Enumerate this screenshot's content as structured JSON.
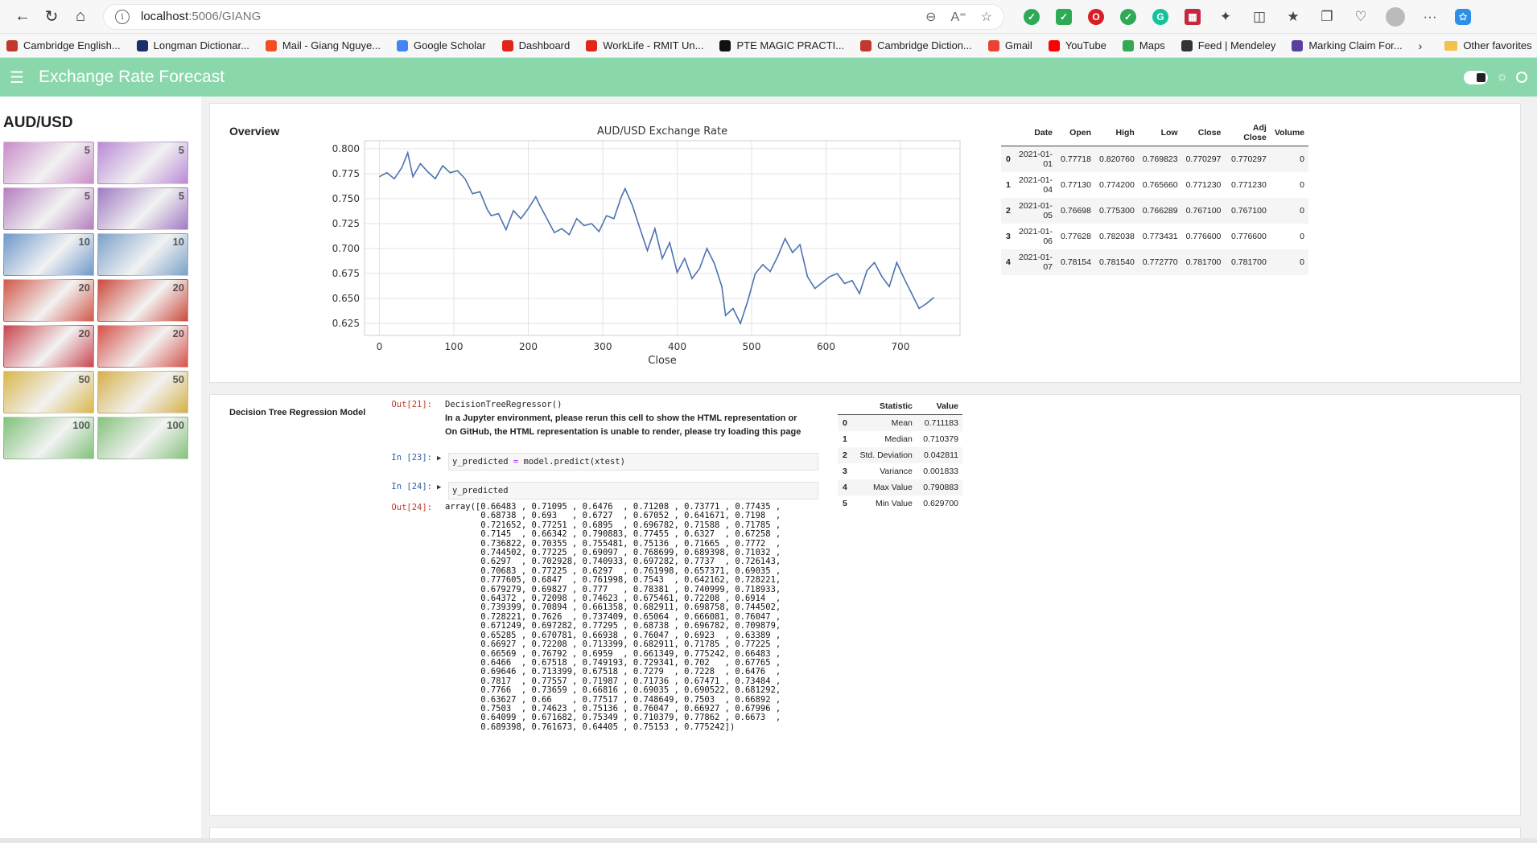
{
  "browser": {
    "url_host": "localhost",
    "url_path": ":5006/GIANG",
    "bookmarks": [
      {
        "label": "Cambridge English...",
        "color": "#c0392b"
      },
      {
        "label": "Longman Dictionar...",
        "color": "#1c2f6b"
      },
      {
        "label": "Mail - Giang Nguye...",
        "color": "#f25022"
      },
      {
        "label": "Google Scholar",
        "color": "#4285f4"
      },
      {
        "label": "Dashboard",
        "color": "#e1251b"
      },
      {
        "label": "WorkLife - RMIT Un...",
        "color": "#e1251b"
      },
      {
        "label": "PTE MAGIC PRACTI...",
        "color": "#111111"
      },
      {
        "label": "Cambridge Diction...",
        "color": "#c0392b"
      },
      {
        "label": "Gmail",
        "color": "#ea4335"
      },
      {
        "label": "YouTube",
        "color": "#ff0000"
      },
      {
        "label": "Maps",
        "color": "#34a853"
      },
      {
        "label": "Feed | Mendeley",
        "color": "#333333"
      },
      {
        "label": "Marking Claim For...",
        "color": "#5b3fa0"
      }
    ],
    "other_favorites": "Other favorites"
  },
  "app": {
    "title": "Exchange Rate Forecast",
    "accent": "#8ad7ac"
  },
  "sidebar": {
    "pair": "AUD/USD",
    "notes": [
      {
        "denom": "5",
        "color": "#c98cc9"
      },
      {
        "denom": "5",
        "color": "#b98ad6"
      },
      {
        "denom": "5",
        "color": "#b47fbf"
      },
      {
        "denom": "5",
        "color": "#a07bc4"
      },
      {
        "denom": "10",
        "color": "#6f98cc"
      },
      {
        "denom": "10",
        "color": "#7ba1c9"
      },
      {
        "denom": "20",
        "color": "#d1584a"
      },
      {
        "denom": "20",
        "color": "#cc4a3c"
      },
      {
        "denom": "20",
        "color": "#c9454f"
      },
      {
        "denom": "20",
        "color": "#d6524a"
      },
      {
        "denom": "50",
        "color": "#d9b64c"
      },
      {
        "denom": "50",
        "color": "#d6b04a"
      },
      {
        "denom": "100",
        "color": "#7fc27a"
      },
      {
        "denom": "100",
        "color": "#86c27d"
      }
    ]
  },
  "overview": {
    "title": "Overview",
    "table": {
      "columns": [
        "",
        "Date",
        "Open",
        "High",
        "Low",
        "Close",
        "Adj Close",
        "Volume"
      ],
      "rows": [
        [
          "0",
          "2021-01-01",
          "0.77718",
          "0.820760",
          "0.769823",
          "0.770297",
          "0.770297",
          "0"
        ],
        [
          "1",
          "2021-01-04",
          "0.77130",
          "0.774200",
          "0.765660",
          "0.771230",
          "0.771230",
          "0"
        ],
        [
          "2",
          "2021-01-05",
          "0.76698",
          "0.775300",
          "0.766289",
          "0.767100",
          "0.767100",
          "0"
        ],
        [
          "3",
          "2021-01-06",
          "0.77628",
          "0.782038",
          "0.773431",
          "0.776600",
          "0.776600",
          "0"
        ],
        [
          "4",
          "2021-01-07",
          "0.78154",
          "0.781540",
          "0.772770",
          "0.781700",
          "0.781700",
          "0"
        ]
      ]
    }
  },
  "chart_data": {
    "type": "line",
    "title": "AUD/USD Exchange Rate",
    "xlabel": "Close",
    "ylabel": "",
    "xlim": [
      -20,
      780
    ],
    "ylim": [
      0.613,
      0.808
    ],
    "x_ticks": [
      0,
      100,
      200,
      300,
      400,
      500,
      600,
      700
    ],
    "y_ticks": [
      "0.625",
      "0.650",
      "0.675",
      "0.700",
      "0.725",
      "0.750",
      "0.775",
      "0.800"
    ],
    "grid": true,
    "line_color": "#4c72b0",
    "series": [
      {
        "x": [
          0,
          10,
          20,
          30,
          38,
          45,
          55,
          65,
          75,
          85,
          95,
          105,
          115,
          125,
          135,
          145,
          150,
          160,
          170,
          180,
          190,
          200,
          210,
          215,
          225,
          235,
          245,
          255,
          265,
          275,
          285,
          295,
          305,
          315,
          325,
          330,
          340,
          350,
          360,
          370,
          380,
          390,
          400,
          410,
          420,
          430,
          440,
          450,
          460,
          465,
          475,
          485,
          495,
          505,
          515,
          525,
          535,
          545,
          555,
          565,
          575,
          585,
          595,
          605,
          615,
          625,
          635,
          645,
          655,
          665,
          675,
          685,
          695,
          705,
          715,
          725,
          735,
          745
        ],
        "y": [
          0.772,
          0.776,
          0.77,
          0.781,
          0.796,
          0.772,
          0.785,
          0.777,
          0.77,
          0.783,
          0.776,
          0.778,
          0.77,
          0.755,
          0.757,
          0.739,
          0.733,
          0.735,
          0.719,
          0.738,
          0.73,
          0.74,
          0.752,
          0.744,
          0.73,
          0.716,
          0.72,
          0.714,
          0.73,
          0.723,
          0.725,
          0.717,
          0.733,
          0.73,
          0.752,
          0.76,
          0.743,
          0.72,
          0.698,
          0.72,
          0.69,
          0.706,
          0.676,
          0.69,
          0.67,
          0.68,
          0.7,
          0.685,
          0.662,
          0.633,
          0.64,
          0.625,
          0.648,
          0.675,
          0.684,
          0.677,
          0.692,
          0.71,
          0.696,
          0.704,
          0.672,
          0.66,
          0.666,
          0.672,
          0.675,
          0.665,
          0.668,
          0.655,
          0.678,
          0.686,
          0.672,
          0.662,
          0.686,
          0.67,
          0.655,
          0.64,
          0.645,
          0.651
        ]
      }
    ]
  },
  "model": {
    "title": "Decision Tree Regression Model",
    "cells": {
      "out21_prompt": "Out[21]:",
      "out21_repr": "DecisionTreeRegressor()",
      "out21_note1": "In a Jupyter environment, please rerun this cell to show the HTML representation or",
      "out21_note2": "On GitHub, the HTML representation is unable to render, please try loading this page",
      "in23_prompt": "In [23]:",
      "in23_lhs": "y_predicted ",
      "in23_op": "=",
      "in23_rhs": " model.predict(xtest)",
      "in24_prompt": "In [24]:",
      "in24_code": "y_predicted",
      "out24_prompt": "Out[24]:",
      "out24_text": "array([0.66483 , 0.71095 , 0.6476  , 0.71208 , 0.73771 , 0.77435 ,\n       0.68738 , 0.693   , 0.6727  , 0.67052 , 0.641671, 0.7198  ,\n       0.721652, 0.77251 , 0.6895  , 0.696782, 0.71588 , 0.71785 ,\n       0.7145  , 0.66342 , 0.790883, 0.77455 , 0.6327  , 0.67258 ,\n       0.736822, 0.70355 , 0.755481, 0.75136 , 0.71665 , 0.7772  ,\n       0.744502, 0.77225 , 0.69097 , 0.768699, 0.689398, 0.71032 ,\n       0.6297  , 0.702928, 0.740933, 0.697282, 0.7737  , 0.726143,\n       0.70683 , 0.77225 , 0.6297  , 0.761998, 0.657371, 0.69035 ,\n       0.777605, 0.6847  , 0.761998, 0.7543  , 0.642162, 0.728221,\n       0.679279, 0.69827 , 0.777   , 0.78381 , 0.740999, 0.718933,\n       0.64372 , 0.72098 , 0.74623 , 0.675461, 0.72208 , 0.6914  ,\n       0.739399, 0.70894 , 0.661358, 0.682911, 0.698758, 0.744502,\n       0.728221, 0.7626  , 0.737409, 0.65064 , 0.666081, 0.76047 ,\n       0.671249, 0.697282, 0.77295 , 0.68738 , 0.696782, 0.709879,\n       0.65285 , 0.670781, 0.66938 , 0.76047 , 0.6923  , 0.63389 ,\n       0.66927 , 0.72208 , 0.713399, 0.682911, 0.71785 , 0.77225 ,\n       0.66569 , 0.76792 , 0.6959  , 0.661349, 0.775242, 0.66483 ,\n       0.6466  , 0.67518 , 0.749193, 0.729341, 0.702   , 0.67765 ,\n       0.69646 , 0.713399, 0.67518 , 0.7279  , 0.7228  , 0.6476  ,\n       0.7817  , 0.77557 , 0.71987 , 0.71736 , 0.67471 , 0.73484 ,\n       0.7766  , 0.73659 , 0.66816 , 0.69035 , 0.690522, 0.681292,\n       0.63627 , 0.66    , 0.77517 , 0.748649, 0.7503  , 0.66892 ,\n       0.7503  , 0.74623 , 0.75136 , 0.76047 , 0.66927 , 0.67996 ,\n       0.64099 , 0.671682, 0.75349 , 0.710379, 0.77862 , 0.6673  ,\n       0.689398, 0.761673, 0.64405 , 0.75153 , 0.775242])"
    },
    "stats": {
      "columns": [
        "",
        "Statistic",
        "Value"
      ],
      "rows": [
        [
          "0",
          "Mean",
          "0.711183"
        ],
        [
          "1",
          "Median",
          "0.710379"
        ],
        [
          "2",
          "Std. Deviation",
          "0.042811"
        ],
        [
          "3",
          "Variance",
          "0.001833"
        ],
        [
          "4",
          "Max Value",
          "0.790883"
        ],
        [
          "5",
          "Min Value",
          "0.629700"
        ]
      ]
    }
  }
}
